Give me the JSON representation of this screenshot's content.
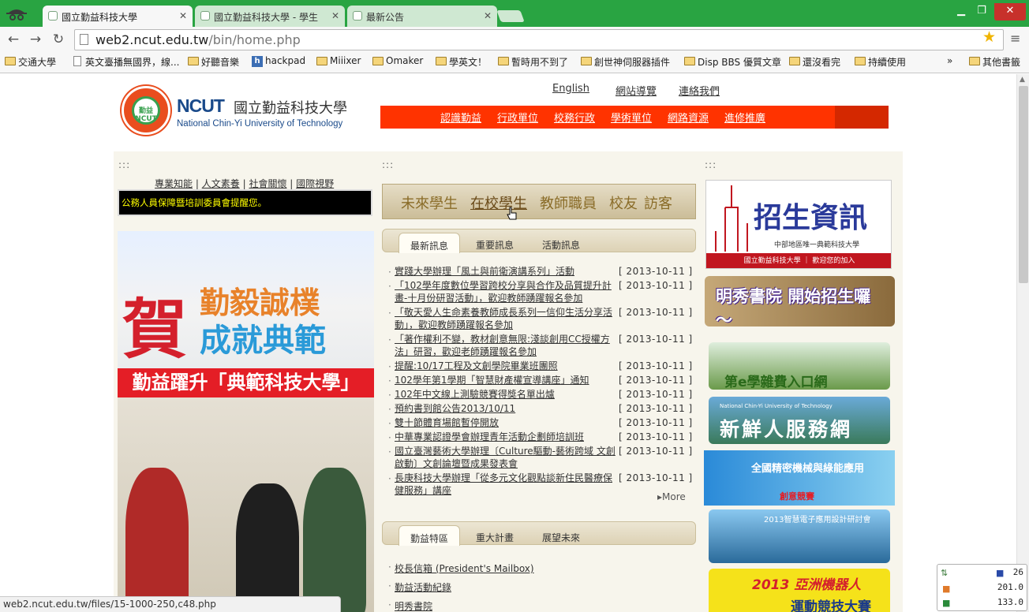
{
  "browser": {
    "tabs": [
      {
        "title": "國立勤益科技大學",
        "active": true
      },
      {
        "title": "國立勤益科技大學 - 學生",
        "active": false
      },
      {
        "title": "最新公告",
        "active": false
      }
    ],
    "window_controls": {
      "minimize": "▁",
      "maximize": "❐",
      "close": "✕"
    },
    "url_host": "web2.ncut.edu.tw",
    "url_path": "/bin/home.php",
    "bookmarks": [
      "交通大學",
      "英文臺播無國界，線...",
      "好聽音樂",
      "hackpad",
      "Miiixer",
      "Omaker",
      "學英文！",
      "暫時用不到了",
      "創世神伺服器插件",
      "Disp BBS 優質文章",
      "還沒看完",
      "持續使用"
    ],
    "bookmarks_overflow": "»",
    "other_bookmarks": "其他書籤",
    "status_url": "web2.ncut.edu.tw/files/15-1000-250,c48.php"
  },
  "site": {
    "top_links": [
      "English",
      "網站導覽",
      "連絡我們"
    ],
    "logo": {
      "abbr": "NCUT",
      "name_cn": "國立勤益科技大學",
      "name_en": "National Chin-Yi University of Technology",
      "seal_text": "勤益 NCUT"
    },
    "main_nav": [
      "認識勤益",
      "行政單位",
      "校務行政",
      "學術單位",
      "網路資源",
      "進修推廣"
    ],
    "col_marker": ":::",
    "sub_nav": [
      "專業知能",
      "人文素養",
      "社會關懷",
      "國際視野"
    ],
    "sub_nav_sep": "|",
    "marquee_text": "公務人員保障暨培訓委員會提醒您。",
    "banner": {
      "he": "賀",
      "line1": "勤毅誠樸",
      "line2": "成就典範",
      "strip": "勤益躍升「典範科技大學」"
    },
    "roles": [
      "未來學生",
      "在校學生",
      "教師職員",
      "校友",
      "訪客"
    ],
    "news_tabs": [
      "最新訊息",
      "重要訊息",
      "活動訊息"
    ],
    "news": [
      {
        "title": "實踐大學辦理「風土與前衛演講系列」活動",
        "date": "[ 2013-10-11 ]"
      },
      {
        "title": "「102學年度數位學習跨校分享與合作及品質提升計畫-十月份研習活動」，歡迎教師踴躍報名參加",
        "date": "[ 2013-10-11 ]"
      },
      {
        "title": "「敬天愛人生命素養教師成長系列一信仰生活分享活動」，歡迎教師踴躍報名參加",
        "date": "[ 2013-10-11 ]"
      },
      {
        "title": "「著作權利不變，教材創意無限:淺談創用CC授權方法」研習，歡迎老師踴躍報名參加",
        "date": "[ 2013-10-11 ]"
      },
      {
        "title": "提醒:10/17工程及文創學院畢業班團照",
        "date": "[ 2013-10-11 ]"
      },
      {
        "title": "102學年第1學期「智慧財產權宣導講座」通知",
        "date": "[ 2013-10-11 ]"
      },
      {
        "title": "102年中文線上測驗競賽得獎名單出爐",
        "date": "[ 2013-10-11 ]"
      },
      {
        "title": "預約書到館公告2013/10/11",
        "date": "[ 2013-10-11 ]"
      },
      {
        "title": "雙十節體育場館暫停開放",
        "date": "[ 2013-10-11 ]"
      },
      {
        "title": "中華專業認證學會辦理青年活動企劃師培訓班",
        "date": "[ 2013-10-11 ]"
      },
      {
        "title": "國立臺灣藝術大學辦理〔Culture驅動-藝術跨域 文創啟動〕文創論壇暨成果發表會",
        "date": "[ 2013-10-11 ]"
      },
      {
        "title": "長庚科技大學辦理「從多元文化觀點談新住民醫療保健服務」講座",
        "date": "[ 2013-10-11 ]"
      }
    ],
    "more": "More",
    "feature_tabs": [
      "勤益特區",
      "重大計畫",
      "展望未來"
    ],
    "features": [
      "校長信箱 (President's Mailbox)",
      "勤益活動紀錄",
      "明秀書院"
    ],
    "side_banners": [
      {
        "title": "招生資訊",
        "sub": "中部地區唯一典範科技大學",
        "foot": "國立勤益科技大學 ｜ 歡迎您的加入"
      },
      {
        "title": "明秀書院 開始招生囉～"
      },
      {
        "title": "第e學雜費入口網"
      },
      {
        "title": "新鮮人服務網",
        "sub": "National Chin-Yi University of Technology"
      },
      {
        "title": "全國精密機械與綠能應用",
        "sub": "創意競賽"
      },
      {
        "title": "2013智慧電子應用設計研討會"
      },
      {
        "title": "2013 亞洲機器人",
        "sub": "運動競技大賽"
      }
    ]
  },
  "tray": {
    "n1": "26",
    "n2": "201.0",
    "n3": "133.0"
  },
  "colors": {
    "tabstrip": "#29a442",
    "nav": "#ff3300"
  }
}
